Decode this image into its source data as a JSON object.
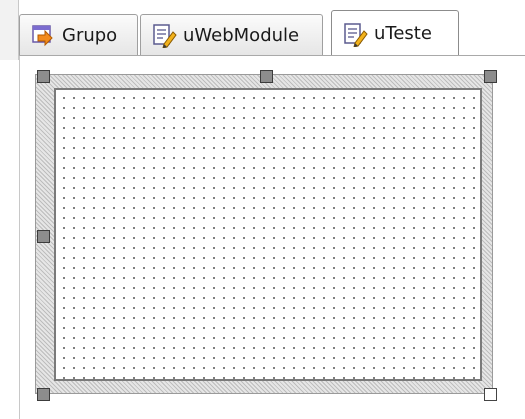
{
  "tabs": [
    {
      "label": "Grupo",
      "icon": "form-arrow-icon",
      "active": false
    },
    {
      "label": "uWebModule",
      "icon": "unit-pencil-icon",
      "active": false
    },
    {
      "label": "uTeste",
      "icon": "unit-pencil-icon",
      "active": true
    }
  ],
  "colors": {
    "tab_border": "#9f9f9f",
    "frame_hatch": "#bdbdbd",
    "grid_dot": "#5a5a5a",
    "handle_fill": "#8d8d8d"
  }
}
